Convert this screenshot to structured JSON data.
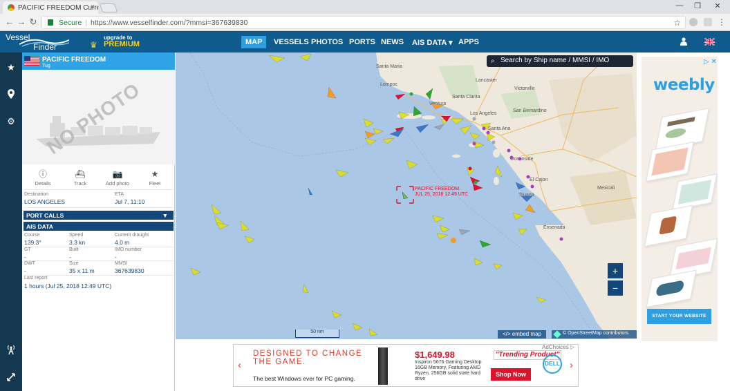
{
  "browser": {
    "tab_title": "PACIFIC FREEDOM Curren",
    "tab_close": "×",
    "url_secure": "Secure",
    "url": "https://www.vesselfinder.com/?mmsi=367639830",
    "back": "←",
    "forward": "→",
    "reload": "↻",
    "win_min": "—",
    "win_max": "❐",
    "win_close": "✕",
    "star": "☆"
  },
  "site": {
    "logo_top": "Vessel",
    "logo_bottom": "Finder",
    "upgrade_to": "upgrade to",
    "premium": "PREMIUM",
    "nav": [
      "MAP",
      "VESSELS",
      "PHOTOS",
      "PORTS",
      "NEWS",
      "AIS DATA",
      "APPS"
    ],
    "nav_caret": "▾"
  },
  "vessel": {
    "name": "PACIFIC FREEDOM",
    "type": "Tug",
    "no_photo": "NO PHOTO",
    "actions": [
      "Details",
      "Track",
      "Add photo",
      "Fleet"
    ],
    "destination_label": "Destination",
    "destination": "LOS ANGELES",
    "eta_label": "ETA",
    "eta": "Jul 7, 11:10",
    "port_calls": "PORT CALLS",
    "port_calls_caret": "▼",
    "ais_data": "AIS DATA",
    "course_label": "Course",
    "course": "139.3°",
    "speed_label": "Speed",
    "speed": "3.3 kn",
    "draught_label": "Current draught",
    "draught": "4.0 m",
    "gt_label": "GT",
    "gt": "-",
    "built_label": "Built",
    "built": "-",
    "imo_label": "IMO number",
    "imo": "-",
    "dwt_label": "DWT",
    "dwt": "-",
    "size_label": "Size",
    "size": "35 x 11 m",
    "mmsi_label": "MMSI",
    "mmsi": "367639830",
    "last_report_label": "Last report",
    "last_report": "1 hours (Jul 25, 2018 12:49 UTC)"
  },
  "map": {
    "search_placeholder": "Search by Ship name / MMSI / IMO",
    "vessel_label": "PACIFIC FREEDOM",
    "vessel_time": "JUL 25, 2018 12:49 UTC",
    "zoom_in": "+",
    "zoom_out": "−",
    "scale": "50 nm",
    "embed": "</> embed map",
    "attribution": "© OpenStreetMap contributors.",
    "cities": {
      "santa_maria": "Santa Maria",
      "lompoc": "Lompoc",
      "santa_clarita": "Santa Clarita",
      "lancaster": "Lancaster",
      "victorville": "Victorville",
      "ventura": "Ventura",
      "los_angeles": "Los Angeles",
      "san_bernardino": "San Bernardino",
      "santa_ana": "Santa Ana",
      "oceanside": "Oceanside",
      "el_cajon": "El Cajon",
      "tijuana": "Tijuana",
      "mexicali": "Mexicali",
      "ensenada": "Ensenada"
    }
  },
  "ad_right": {
    "brand": "weebly",
    "cta": "START YOUR WEBSITE",
    "choices": "▷ ✕",
    "accent": "#2e9fe0"
  },
  "ad_bottom": {
    "headline": "DESIGNED TO CHANGE THE GAME.",
    "subline": "The best Windows ever for PC gaming.",
    "price": "$1,649.98",
    "product": "Inspiron 5676 Gaming Desktop 16GB Memory, Featuring AMD Ryzen, 256GB solid state hard drive",
    "trending": "\"Trending Product\"",
    "shop": "Shop Now",
    "brand": "DELL",
    "adchoices": "AdChoices ▷",
    "prev": "‹",
    "next": "›"
  }
}
